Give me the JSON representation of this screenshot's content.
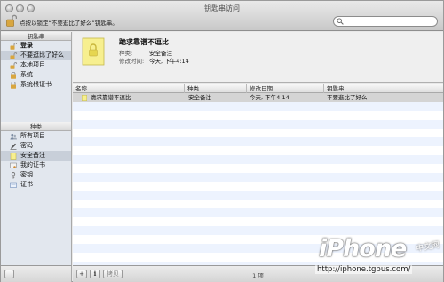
{
  "window": {
    "title": "钥匙串访问",
    "lock_hint": "点按以锁定“不要逛比了好么”钥匙串。",
    "search": {
      "value": "",
      "placeholder": ""
    }
  },
  "sidebar": {
    "keychains_header": "钥匙串",
    "keychains": [
      {
        "label": "登录",
        "icon": "lock-open-icon",
        "selected": false
      },
      {
        "label": "不要逛比了好么",
        "icon": "lock-open-icon",
        "selected": true
      },
      {
        "label": "本地项目",
        "icon": "lock-open-icon",
        "selected": false
      },
      {
        "label": "系统",
        "icon": "lock-icon",
        "selected": false
      },
      {
        "label": "系统根证书",
        "icon": "lock-icon",
        "selected": false
      }
    ],
    "category_header": "种类",
    "categories": [
      {
        "label": "所有项目",
        "icon": "people-icon",
        "selected": false
      },
      {
        "label": "密码",
        "icon": "pencil-icon",
        "selected": false
      },
      {
        "label": "安全备注",
        "icon": "note-icon",
        "selected": true
      },
      {
        "label": "我的证书",
        "icon": "certificate-icon",
        "selected": false
      },
      {
        "label": "密钥",
        "icon": "key-icon",
        "selected": false
      },
      {
        "label": "证书",
        "icon": "certificate-icon",
        "selected": false
      }
    ]
  },
  "detail": {
    "title": "跪求靠谱不逗比",
    "kind_label": "种类:",
    "kind_value": "安全备注",
    "modified_label": "修改时间:",
    "modified_value": "今天, 下午4:14"
  },
  "table": {
    "columns": [
      "名称",
      "种类",
      "修改日期",
      "钥匙串"
    ],
    "rows": [
      {
        "name": "跪求靠谱不逗比",
        "kind": "安全备注",
        "modified": "今天, 下午4:14",
        "keychain": "不要逛比了好么",
        "selected": true
      }
    ]
  },
  "bottom": {
    "add_label": "+",
    "info_label": "i",
    "copy_label": "拷贝",
    "count": "1 项"
  },
  "watermark": {
    "logo": "iPhone",
    "cn": "中文网",
    "url": "http://iphone.tgbus.com/"
  },
  "colors": {
    "selection": "#c8cfd9",
    "row_selected": "#d4d4d4",
    "row_alt": "#edf3fe",
    "note_yellow": "#f7ef8f"
  }
}
